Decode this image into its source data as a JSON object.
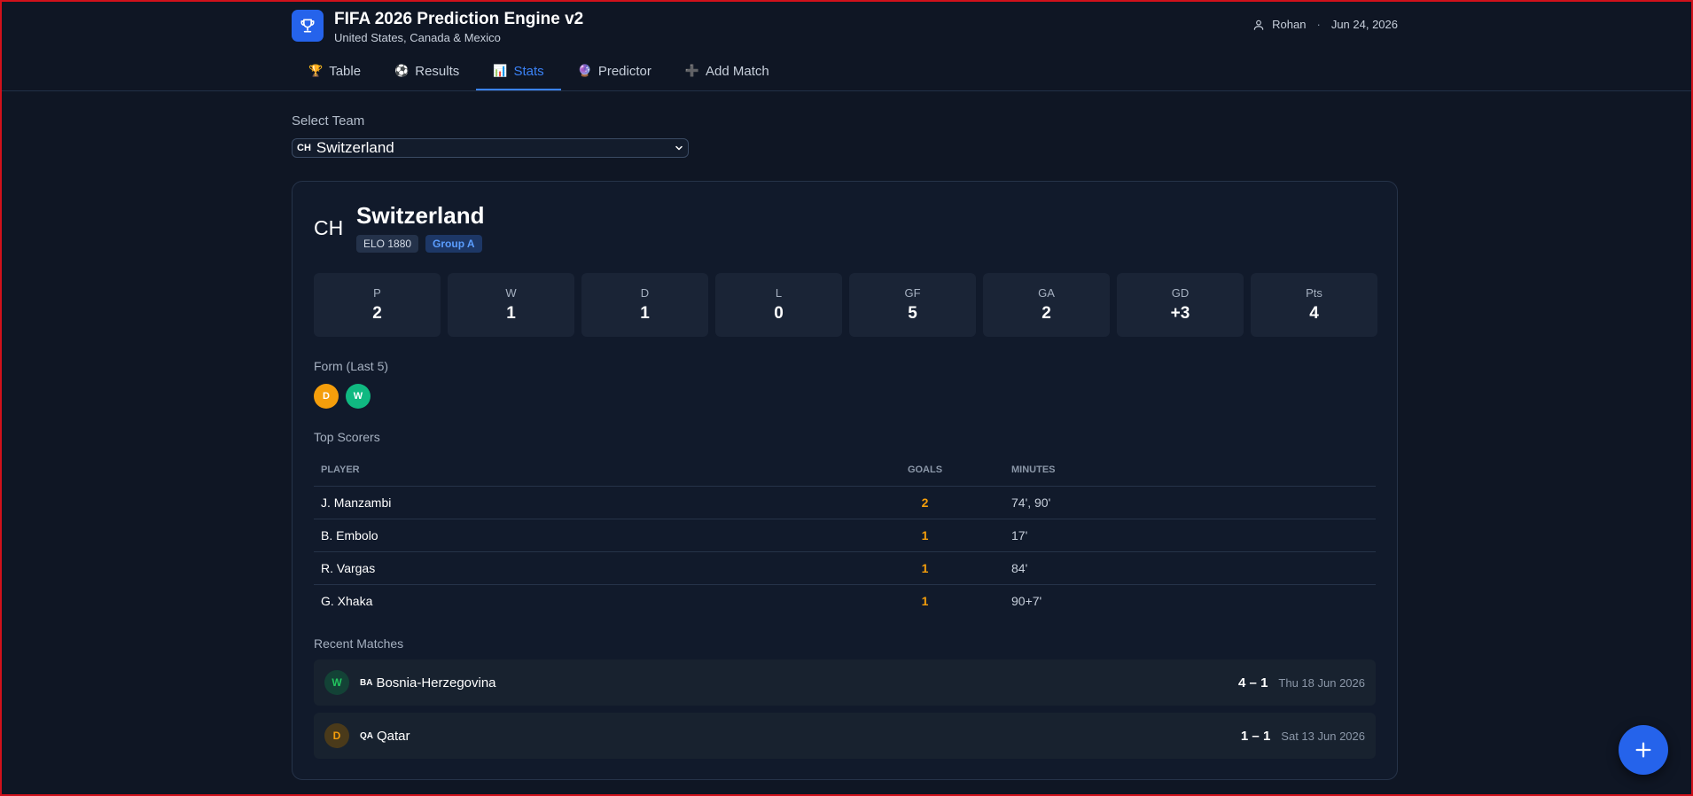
{
  "header": {
    "title": "FIFA 2026 Prediction Engine v2",
    "subtitle": "United States, Canada & Mexico",
    "user": "Rohan",
    "separator": "·",
    "date": "Jun 24, 2026",
    "icons": {
      "logo": "trophy-icon",
      "user": "user-icon"
    }
  },
  "tabs": [
    {
      "label": "Table",
      "icon": "🏆",
      "active": false
    },
    {
      "label": "Results",
      "icon": "⚽",
      "active": false
    },
    {
      "label": "Stats",
      "icon": "📊",
      "active": true
    },
    {
      "label": "Predictor",
      "icon": "🔮",
      "active": false
    },
    {
      "label": "Add Match",
      "icon": "➕",
      "active": false
    }
  ],
  "team_select": {
    "label": "Select Team",
    "code": "CH",
    "value": "Switzerland"
  },
  "team": {
    "code": "CH",
    "name": "Switzerland",
    "elo": "ELO 1880",
    "group": "Group A"
  },
  "stats": [
    {
      "label": "P",
      "value": "2"
    },
    {
      "label": "W",
      "value": "1"
    },
    {
      "label": "D",
      "value": "1"
    },
    {
      "label": "L",
      "value": "0"
    },
    {
      "label": "GF",
      "value": "5"
    },
    {
      "label": "GA",
      "value": "2"
    },
    {
      "label": "GD",
      "value": "+3"
    },
    {
      "label": "Pts",
      "value": "4"
    }
  ],
  "form": {
    "title": "Form (Last 5)",
    "results": [
      "D",
      "W"
    ]
  },
  "scorers": {
    "title": "Top Scorers",
    "headers": {
      "player": "PLAYER",
      "goals": "GOALS",
      "minutes": "MINUTES"
    },
    "rows": [
      {
        "player": "J. Manzambi",
        "goals": "2",
        "minutes": "74', 90'"
      },
      {
        "player": "B. Embolo",
        "goals": "1",
        "minutes": "17'"
      },
      {
        "player": "R. Vargas",
        "goals": "1",
        "minutes": "84'"
      },
      {
        "player": "G. Xhaka",
        "goals": "1",
        "minutes": "90+7'"
      }
    ]
  },
  "recent": {
    "title": "Recent Matches",
    "matches": [
      {
        "result": "W",
        "code": "BA",
        "opponent": "Bosnia-Herzegovina",
        "score": "4 – 1",
        "date": "Thu 18 Jun 2026"
      },
      {
        "result": "D",
        "code": "QA",
        "opponent": "Qatar",
        "score": "1 – 1",
        "date": "Sat 13 Jun 2026"
      }
    ]
  },
  "colors": {
    "accent": "#3b82f6",
    "draw": "#f59e0b",
    "win": "#10b981",
    "background": "#0f1624"
  }
}
